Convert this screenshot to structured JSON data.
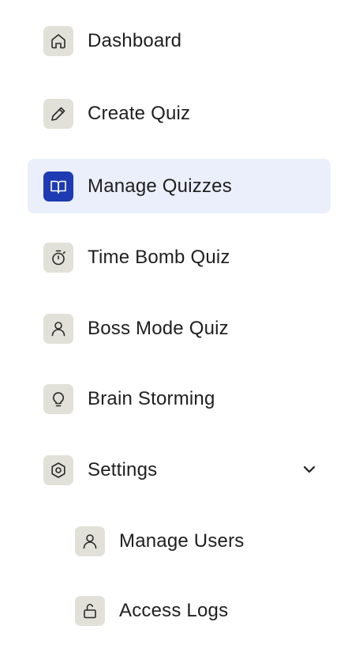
{
  "nav": {
    "items": [
      {
        "label": "Dashboard",
        "icon": "home-icon"
      },
      {
        "label": "Create Quiz",
        "icon": "pencil-icon"
      },
      {
        "label": "Manage Quizzes",
        "icon": "book-icon",
        "active": true
      },
      {
        "label": "Time Bomb Quiz",
        "icon": "stopwatch-icon"
      },
      {
        "label": "Boss Mode Quiz",
        "icon": "user-icon"
      },
      {
        "label": "Brain Storming",
        "icon": "lightbulb-icon"
      },
      {
        "label": "Settings",
        "icon": "hexagon-settings-icon",
        "expanded": true
      }
    ],
    "sub_items": [
      {
        "label": "Manage Users",
        "icon": "user-icon"
      },
      {
        "label": "Access Logs",
        "icon": "unlock-icon"
      }
    ]
  },
  "colors": {
    "active_bg": "#ebeffc",
    "active_icon_bg": "#1e3bb3",
    "icon_bg": "#e2e1d9",
    "text": "#1f1f1f"
  }
}
